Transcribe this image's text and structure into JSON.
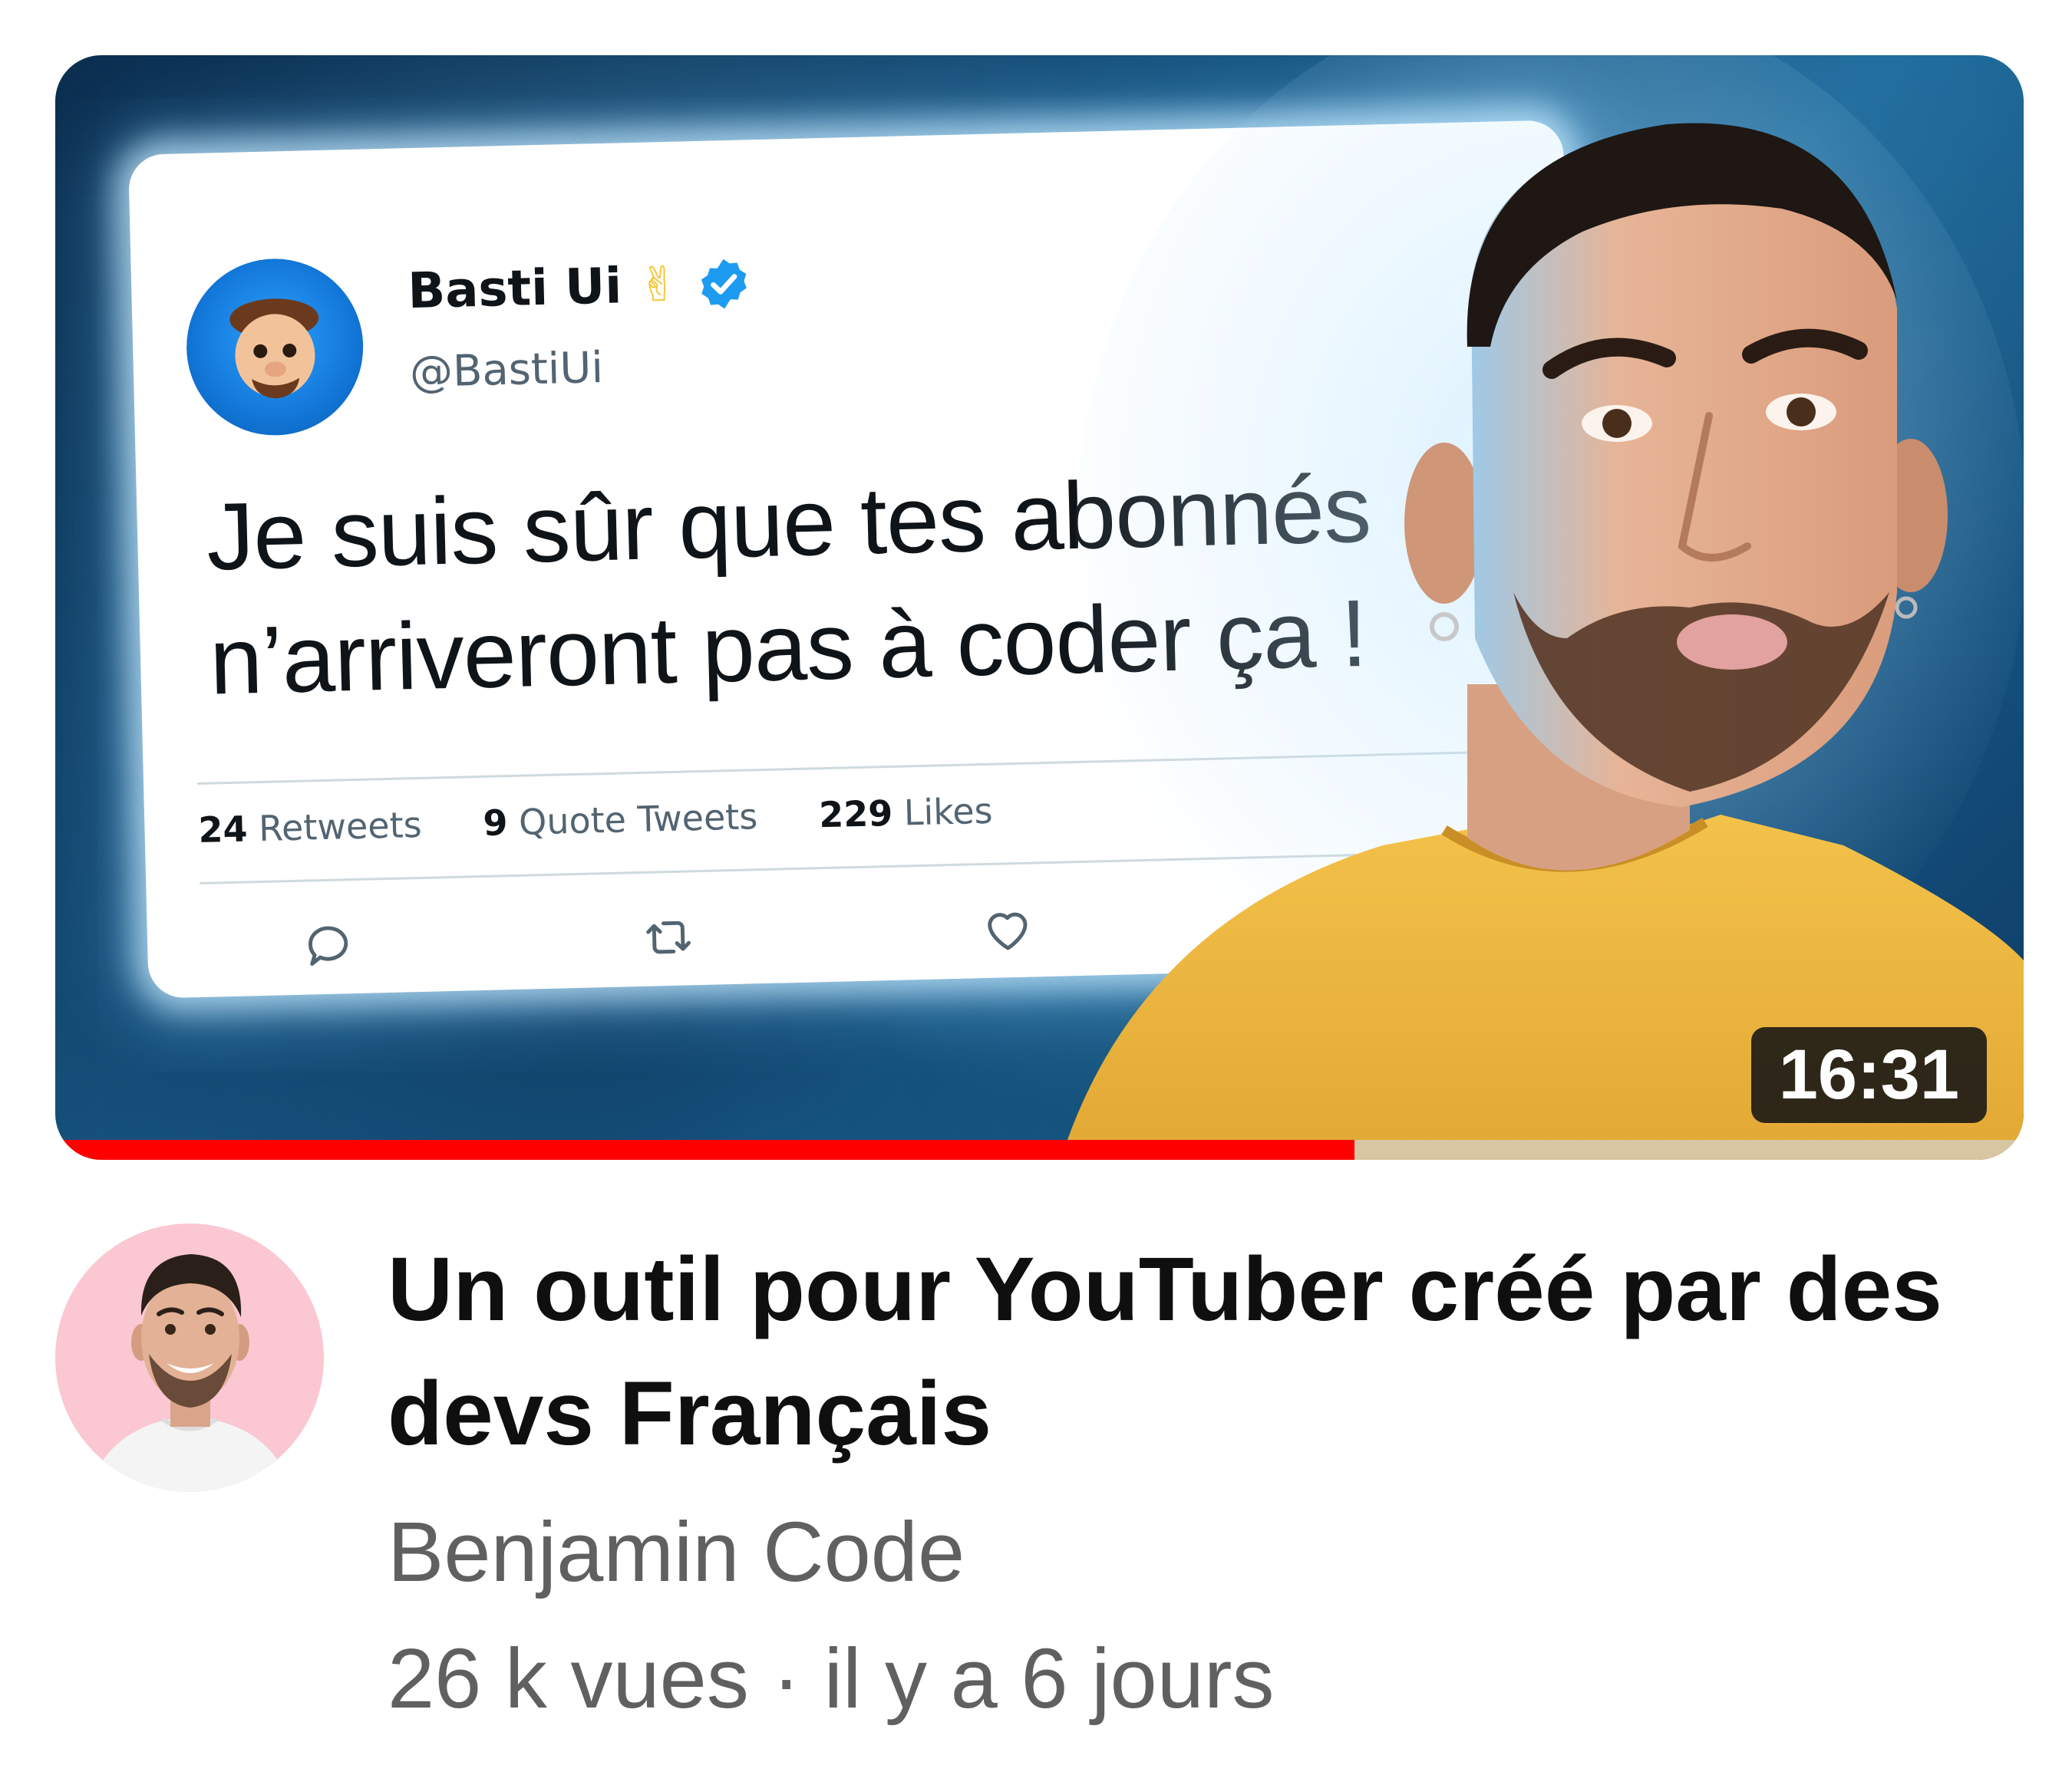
{
  "thumbnail": {
    "tweet": {
      "author_name": "Basti Ui",
      "author_emoji": "✌",
      "handle": "@BastiUi",
      "text_line1": "Je suis sûr que tes abonnés",
      "text_line2": "n’arriveront pas à coder ça !",
      "stats": {
        "retweets_count": "24",
        "retweets_label": "Retweets",
        "quotes_count": "9",
        "quotes_label": "Quote Tweets",
        "likes_count": "229",
        "likes_label": "Likes"
      },
      "icons": [
        "reply-icon",
        "retweet-icon",
        "like-icon",
        "share-icon"
      ]
    },
    "duration": "16:31",
    "watch_progress_fraction": 0.66
  },
  "video": {
    "title": "Un outil pour YouTuber créé par des devs Français",
    "channel": "Benjamin Code",
    "views": "26 k vues",
    "separator": "·",
    "age": "il y a 6 jours"
  },
  "colors": {
    "progress": "#ff0000",
    "progress_track": "#d8c6a2",
    "avatar_bg": "#fac7d3",
    "verified_blue": "#1d9bf0",
    "secondary_text": "#606060"
  }
}
